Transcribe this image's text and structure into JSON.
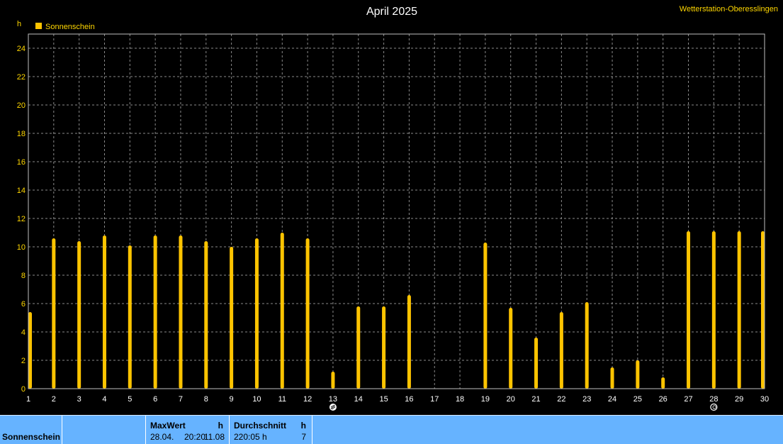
{
  "station": "Wetterstation-Oberesslingen",
  "stats": {
    "row_label": "Sonnenschein",
    "max": {
      "label": "MaxWert",
      "unit": "h",
      "date": "28.04.",
      "time": "20:20",
      "value": "11.08"
    },
    "avg": {
      "label": "Durchschnitt",
      "unit": "h",
      "value": "220:05 h",
      "count": "7"
    }
  },
  "chart_data": {
    "type": "bar",
    "title": "April 2025",
    "ylabel": "h",
    "ylim": [
      0,
      25
    ],
    "yticks": [
      0,
      2,
      4,
      6,
      8,
      10,
      12,
      14,
      16,
      18,
      20,
      22,
      24
    ],
    "grid": true,
    "legend_position": "top-left",
    "series": [
      {
        "name": "Sonnenschein",
        "color": "#ffc400",
        "values": [
          5.4,
          10.6,
          10.4,
          10.8,
          10.1,
          10.8,
          10.8,
          10.4,
          10.0,
          10.6,
          11.0,
          10.6,
          1.2,
          5.8,
          5.8,
          6.6,
          0.0,
          0.0,
          10.3,
          5.7,
          3.6,
          5.4,
          6.1,
          1.5,
          2.0,
          0.8,
          11.1,
          11.1,
          11.1,
          11.1
        ]
      }
    ],
    "categories": [
      "1",
      "2",
      "3",
      "4",
      "5",
      "6",
      "7",
      "8",
      "9",
      "10",
      "11",
      "12",
      "13",
      "14",
      "15",
      "16",
      "17",
      "18",
      "19",
      "20",
      "21",
      "22",
      "23",
      "24",
      "25",
      "26",
      "27",
      "28",
      "29",
      "30"
    ],
    "moon_markers": [
      {
        "day": "13",
        "icon": "full-moon-icon"
      },
      {
        "day": "28",
        "icon": "new-moon-icon"
      }
    ]
  }
}
